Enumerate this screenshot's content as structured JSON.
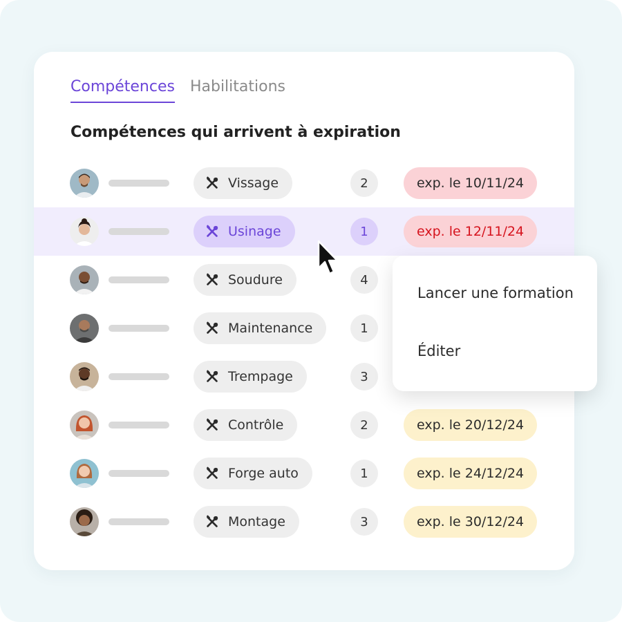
{
  "tabs": [
    {
      "label": "Compétences",
      "active": true
    },
    {
      "label": "Habilitations",
      "active": false
    }
  ],
  "section_title": "Compétences qui arrivent à expiration",
  "rows": [
    {
      "skill": "Vissage",
      "count": "2",
      "expiry": "exp. le 10/11/24",
      "status": "red"
    },
    {
      "skill": "Usinage",
      "count": "1",
      "expiry": "exp. le 12/11/24",
      "status": "red",
      "selected": true
    },
    {
      "skill": "Soudure",
      "count": "4",
      "expiry": "",
      "status": "hidden"
    },
    {
      "skill": "Maintenance",
      "count": "1",
      "expiry": "",
      "status": "hidden"
    },
    {
      "skill": "Trempage",
      "count": "3",
      "expiry": "",
      "status": "hidden"
    },
    {
      "skill": "Contrôle",
      "count": "2",
      "expiry": "exp. le 20/12/24",
      "status": "yellow"
    },
    {
      "skill": "Forge auto",
      "count": "1",
      "expiry": "exp. le 24/12/24",
      "status": "yellow"
    },
    {
      "skill": "Montage",
      "count": "3",
      "expiry": "exp. le 30/12/24",
      "status": "yellow"
    }
  ],
  "context_menu": {
    "items": [
      "Lancer une formation",
      "Éditer"
    ]
  },
  "icons": {
    "skill": "tools-icon",
    "pointer": "cursor-arrow-icon"
  },
  "colors": {
    "accent": "#6b45d8",
    "selected_row": "#f1edfd",
    "badge_red": "#fbd2d6",
    "badge_red_text": "#d6141e",
    "badge_yellow": "#fdf1cc",
    "background": "#eef7f9"
  }
}
